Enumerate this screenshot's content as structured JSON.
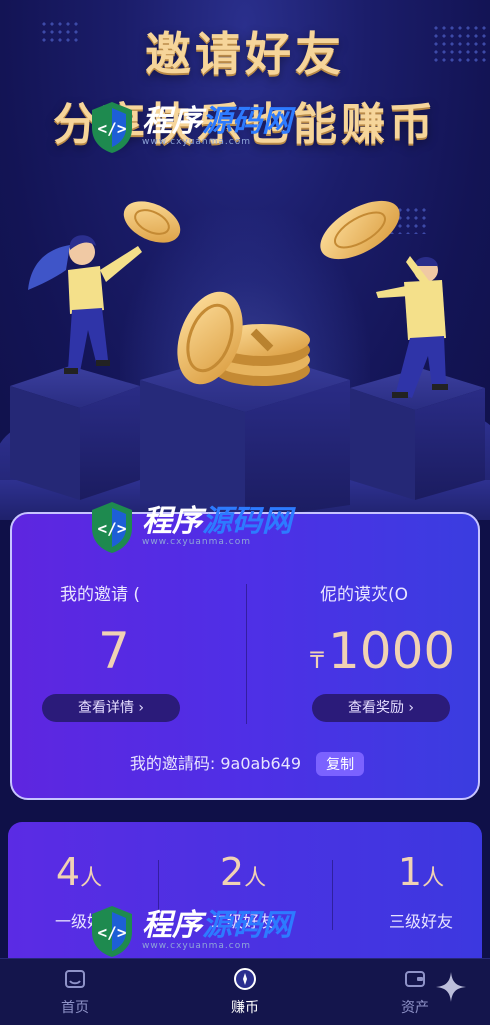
{
  "hero": {
    "title_line1": "邀请好友",
    "title_line2": "分享快乐也能赚币"
  },
  "watermark": {
    "text_white": "程序",
    "text_blue": "源码网",
    "url": "www.cxyuanma.com"
  },
  "invite": {
    "my_invites_label": "我的邀请 (",
    "my_invites_value": "7",
    "details_button": "查看详情 ›",
    "my_rewards_label": "伲的谟苂(O",
    "currency_symbol": "₸",
    "my_rewards_value": "1000",
    "rewards_button": "查看奖励 ›",
    "code_label": "我的邀請码:",
    "code_value": "9a0ab649",
    "copy_button": "复制"
  },
  "levels": [
    {
      "count": "4",
      "unit": "人",
      "name": "一级好"
    },
    {
      "count": "2",
      "unit": "人",
      "name": "二级好友"
    },
    {
      "count": "1",
      "unit": "人",
      "name": "三级好友"
    }
  ],
  "tabbar": {
    "home": "首页",
    "earn": "赚币",
    "assets": "资产"
  },
  "colors": {
    "background": "#0f1048",
    "title_gold": "#f6d59a",
    "card_purple": "#5e26e0",
    "value_peach": "#f0d2b4",
    "watermark_blue": "#2d7bff"
  }
}
